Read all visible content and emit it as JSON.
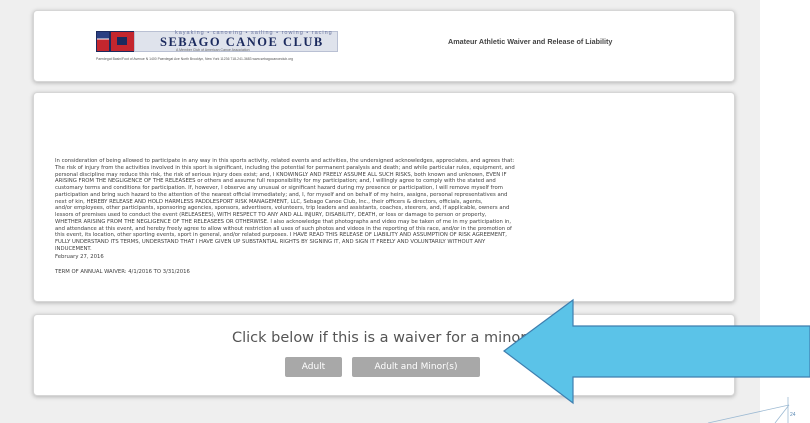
{
  "header": {
    "logo": {
      "tagline": "kayaking • canoeing • sailing • rowing • racing",
      "name": "SEBAGO CANOE CLUB",
      "sub": "A Member Club of American Canoe Association",
      "address": "Paerdegat Basin/Foot of Avenue N   1400 Paerdegat Ave North   Brooklyn, New York 11236   718-241-3683   www.sebagocanoeclub.org"
    },
    "title": "Amateur Athletic Waiver and Release of Liability"
  },
  "waiver": {
    "text": "In consideration of being allowed to participate in any way in this sports activity, related events and activities, the undersigned acknowledges, appreciates, and agrees that:\nThe risk of injury from the activities involved in this sport is significant, including the potential for permanent paralysis and death; and while particular rules, equipment, and\npersonal discipline may reduce this risk, the risk of serious injury does exist; and, I KNOWINGLY AND FREELY ASSUME ALL SUCH RISKS, both known and unknown, EVEN IF\nARISING FROM THE NEGLIGENCE OF THE RELEASEES or others and assume full responsibility for my participation; and, I willingly agree to comply with the stated and\ncustomary terms and conditions for participation. If, however, I observe any unusual or significant hazard during my presence or participation, I will remove myself from\nparticipation and bring such hazard to the attention of the nearest official immediately; and, I, for myself and on behalf of my heirs, assigns, personal representatives and\nnext of kin, HEREBY RELEASE AND HOLD HARMLESS PADDLESPORT RISK MANAGEMENT, LLC, Sebago Canoe Club, Inc., their officers & directors, officials, agents,\nand/or employees, other participants, sponsoring agencies, sponsors, advertisers, volunteers, trip leaders and assistants, coaches, steerers, and, if applicable, owners and\nlessors of premises used to conduct the event (RELEASEES), WITH RESPECT TO ANY AND ALL INJURY, DISABILITY, DEATH, or loss or damage to person or property,\nWHETHER ARISING FROM THE NEGLIGENCE OF THE RELEASEES OR OTHERWISE. I also acknowledge that photographs and video may be taken of me in my participation in,\nand attendance at this event, and hereby freely agree to allow without restriction all uses of such photos and videos in the reporting of this race, and/or in the promotion of\nthis event, its location, other sporting events, sport in general, and/or related purposes. I HAVE READ THIS RELEASE OF LIABILITY AND ASSUMPTION OF RISK AGREEMENT,\nFULLY UNDERSTAND ITS TERMS, UNDERSTAND THAT I HAVE GIVEN UP SUBSTANTIAL RIGHTS BY SIGNING IT, AND SIGN IT FREELY AND VOLUNTARILY WITHOUT ANY\nINDUCEMENT.",
    "date": "February 27, 2016",
    "term": "TERM OF ANNUAL WAIVER: 4/1/2016 TO 3/31/2016"
  },
  "minor": {
    "prompt": "Click below if this is a waiver for a minor",
    "adult_label": "Adult",
    "adult_minor_label": "Adult and Minor(s)"
  },
  "slide_number": "24",
  "colors": {
    "arrow_fill": "#5bc3e8",
    "arrow_stroke": "#3f7faf",
    "button_bg": "#a8a8a8",
    "logo_navy": "#1b2a5e",
    "logo_red": "#c4262e"
  },
  "icons": {
    "callout_arrow": "left-pointing-arrow"
  }
}
